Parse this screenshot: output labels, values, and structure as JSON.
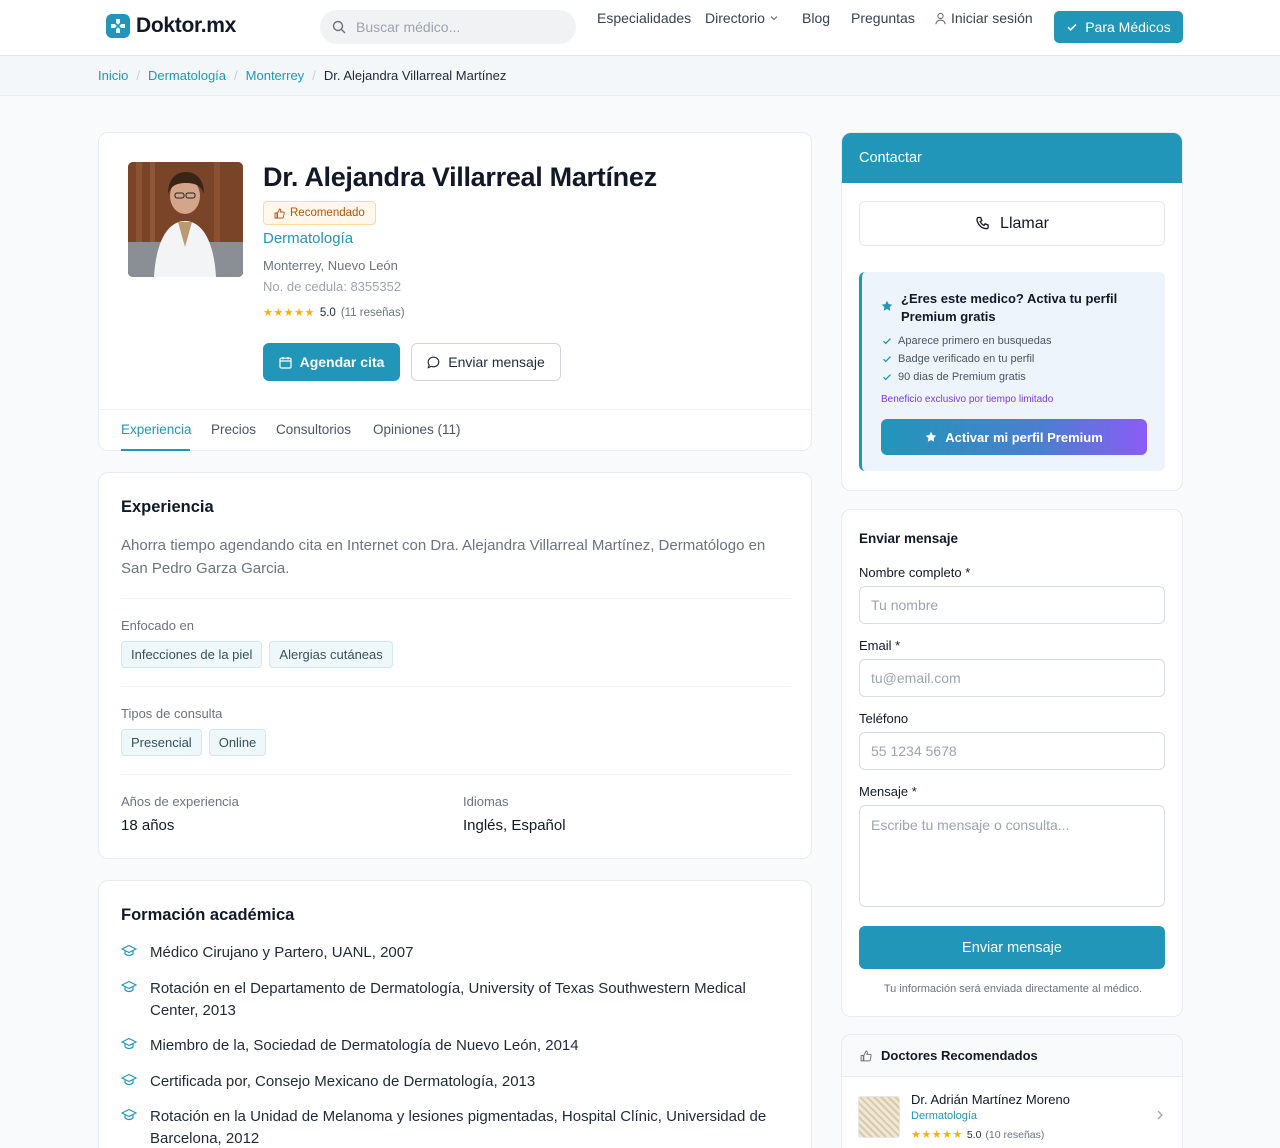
{
  "header": {
    "logo_text": "Doktor.mx",
    "search_placeholder": "Buscar médico...",
    "nav": {
      "especialidades": "Especialidades",
      "directorio": "Directorio",
      "blog": "Blog",
      "preguntas": "Preguntas",
      "login": "Iniciar sesión"
    },
    "cta_label": "Para Médicos"
  },
  "breadcrumb": {
    "inicio": "Inicio",
    "especialidad": "Dermatología",
    "ciudad": "Monterrey",
    "actual": "Dr. Alejandra Villarreal Martínez",
    "separator": "/"
  },
  "profile": {
    "name": "Dr. Alejandra Villarreal Martínez",
    "badge": "Recomendado",
    "specialty": "Dermatología",
    "location": "Monterrey, Nuevo León",
    "cedula": "No. de cedula: 8355352",
    "stars": "★★★★★",
    "rating_value": 5.0,
    "rating_score": "5.0",
    "rating_count": "(11 reseñas)",
    "btn_agendar": "Agendar cita",
    "btn_mensaje": "Enviar mensaje"
  },
  "tabs": {
    "experiencia": "Experiencia",
    "precios": "Precios",
    "consultorios": "Consultorios",
    "opiniones": "Opiniones (11)"
  },
  "experience": {
    "title": "Experiencia",
    "description": "Ahorra tiempo agendando cita en Internet con Dra. Alejandra Villarreal Martínez, Dermatólogo en San Pedro Garza Garcia.",
    "focus_label": "Enfocado en",
    "focus_tags": [
      "Infecciones de la piel",
      "Alergias cutáneas"
    ],
    "consult_label": "Tipos de consulta",
    "consult_tags": [
      "Presencial",
      "Online"
    ],
    "years_label": "Años de experiencia",
    "years_value": "18 años",
    "languages_label": "Idiomas",
    "languages_value": "Inglés, Español"
  },
  "education": {
    "title": "Formación académica",
    "items": [
      "Médico Cirujano y Partero, UANL, 2007",
      "Rotación en el Departamento de Dermatología, University of Texas Southwestern Medical Center, 2013",
      "Miembro de la, Sociedad de Dermatología de Nuevo León, 2014",
      "Certificada por, Consejo Mexicano de Dermatología, 2013",
      "Rotación en la Unidad de Melanoma y lesiones pigmentadas, Hospital Clínic, Universidad de Barcelona, 2012"
    ]
  },
  "contact": {
    "title": "Contactar",
    "call_label": "Llamar",
    "premium": {
      "title": "¿Eres este medico? Activa tu perfil Premium gratis",
      "benefits": [
        "Aparece primero en busquedas",
        "Badge verificado en tu perfil",
        "90 dias de Premium gratis"
      ],
      "note": "Beneficio exclusivo por tiempo limitado",
      "button": "Activar mi perfil Premium"
    }
  },
  "message_form": {
    "title": "Enviar mensaje",
    "name_label": "Nombre completo *",
    "name_placeholder": "Tu nombre",
    "email_label": "Email *",
    "email_placeholder": "tu@email.com",
    "phone_label": "Teléfono",
    "phone_placeholder": "55 1234 5678",
    "message_label": "Mensaje *",
    "message_placeholder": "Escribe tu mensaje o consulta...",
    "submit": "Enviar mensaje",
    "note": "Tu información será enviada directamente al médico."
  },
  "recommended": {
    "title": "Doctores Recomendados",
    "doctor": {
      "name": "Dr. Adrián Martínez Moreno",
      "specialty": "Dermatología",
      "stars": "★★★★★",
      "rating_value": 5.0,
      "rating_score": "5.0",
      "rating_count": "(10 reseñas)"
    }
  },
  "colors": {
    "accent": "#2196b8",
    "star": "#f5b301",
    "premium_purple": "#8b5cf6"
  }
}
